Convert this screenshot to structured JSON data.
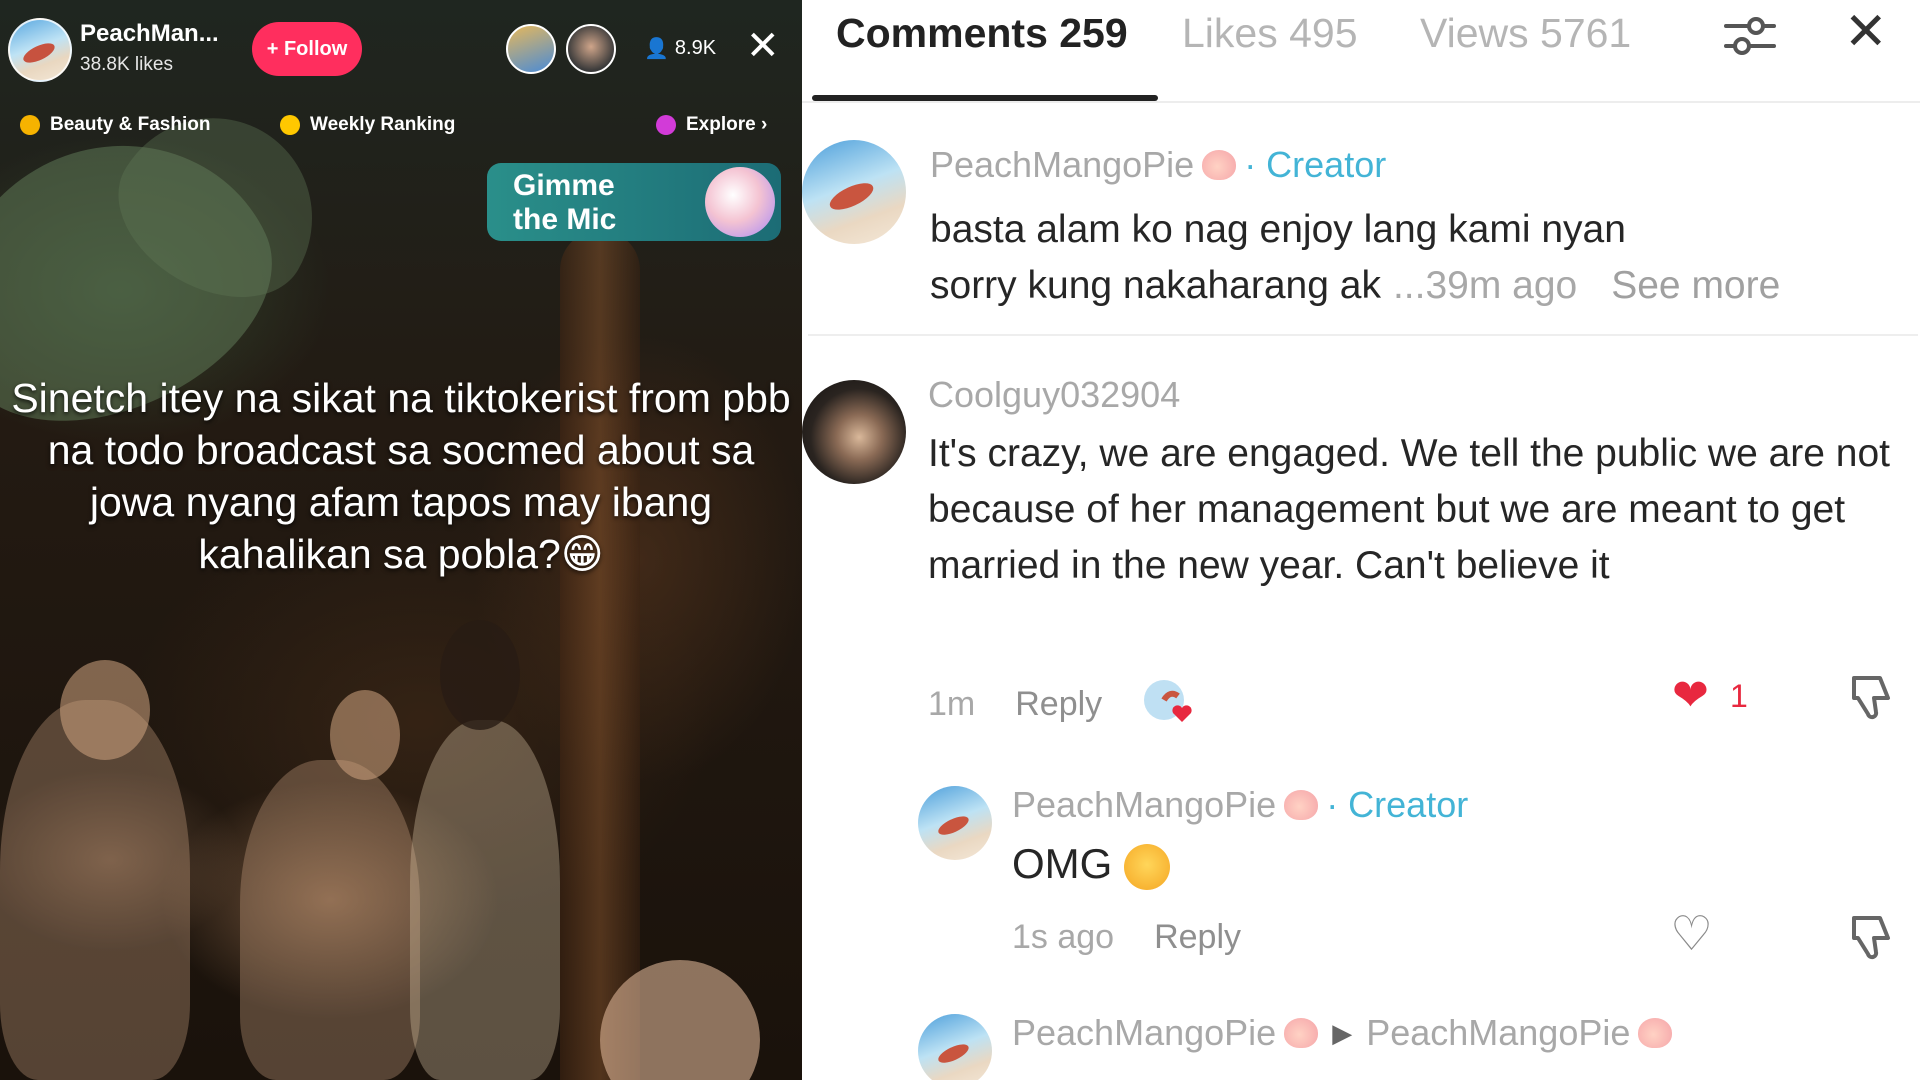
{
  "live": {
    "host_name": "PeachMan...",
    "host_likes": "38.8K likes",
    "follow_label": "+ Follow",
    "viewer_count": "8.9K",
    "close_icon": "close-icon",
    "tags": [
      {
        "label": "Beauty & Fashion",
        "color": "#f6b300"
      },
      {
        "label": "Weekly Ranking",
        "color": "#ffc800"
      },
      {
        "label": "Explore ›",
        "color": "#d23bd8"
      }
    ],
    "promo": {
      "line1": "Gimme",
      "line2": "the Mic"
    },
    "caption": "Sinetch itey na sikat na tiktokerist from pbb na todo broadcast sa socmed about sa jowa nyang afam tapos may ibang kahalikan sa pobla?😁"
  },
  "comments_panel": {
    "tabs": [
      {
        "label": "Comments 259",
        "active": true
      },
      {
        "label": "Likes 495",
        "active": false
      },
      {
        "label": "Views 5761",
        "active": false
      }
    ],
    "filter_icon": "filter-sliders-icon",
    "close_icon": "close-icon",
    "comments": [
      {
        "user": "PeachMangoPie",
        "creator_label": "· Creator",
        "text_line1": "basta alam ko nag enjoy lang kami nyan",
        "text_line2": "sorry kung nakaharang ak",
        "time": "...39m ago",
        "see_more": "See more"
      },
      {
        "user": "Coolguy032904",
        "text": "It's crazy, we are engaged. We tell the public we are not because of her management but we are meant to get married in the new year. Can't believe it",
        "time": "1m",
        "reply": "Reply",
        "likes": "1"
      },
      {
        "user": "PeachMangoPie",
        "creator_label": "· Creator",
        "text": "OMG",
        "time": "1s ago",
        "reply": "Reply"
      },
      {
        "user": "PeachMangoPie",
        "reply_to": "PeachMangoPie"
      }
    ]
  }
}
